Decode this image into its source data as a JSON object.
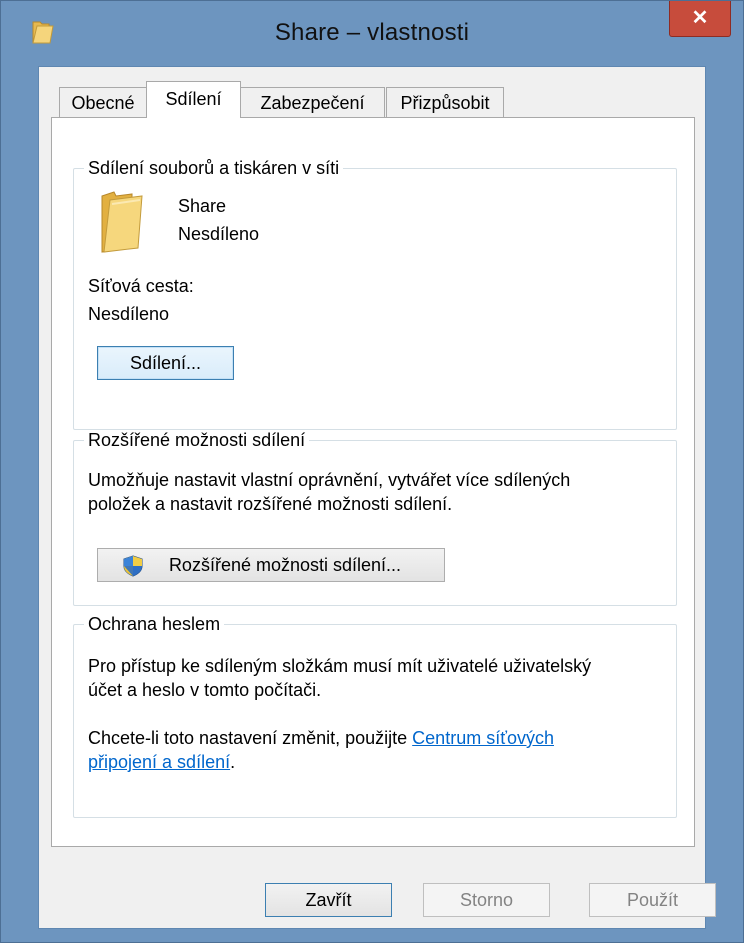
{
  "window": {
    "title": "Share – vlastnosti",
    "close_label": "✕"
  },
  "tabs": [
    {
      "label": "Obecné",
      "active": false
    },
    {
      "label": "Sdílení",
      "active": true
    },
    {
      "label": "Zabezpečení",
      "active": false
    },
    {
      "label": "Přizpůsobit",
      "active": false
    }
  ],
  "sharing_group": {
    "legend": "Sdílení souborů a tiskáren v síti",
    "folder_name": "Share",
    "folder_status": "Nesdíleno",
    "network_path_label": "Síťová cesta:",
    "network_path_value": "Nesdíleno",
    "share_button": "Sdílení..."
  },
  "advanced_group": {
    "legend": "Rozšířené možnosti sdílení",
    "description_line1": "Umožňuje nastavit vlastní oprávnění, vytvářet více sdílených",
    "description_line2": "položek a nastavit rozšířené možnosti sdílení.",
    "advanced_button": "Rozšířené možnosti sdílení..."
  },
  "password_group": {
    "legend": "Ochrana heslem",
    "text_line1": "Pro přístup ke sdíleným složkám musí mít uživatelé uživatelský",
    "text_line2": "účet a heslo v tomto počítači.",
    "change_prefix": "Chcete-li toto nastavení změnit, použijte ",
    "link_line1": "Centrum síťových",
    "link_line2": "připojení a sdílení",
    "change_suffix": "."
  },
  "footer": {
    "close_button": "Zavřít",
    "cancel_button": "Storno",
    "apply_button": "Použít"
  },
  "colors": {
    "frame": "#6d95bf",
    "close": "#c74c3c",
    "link": "#0066cc"
  },
  "icons": {
    "title": "folder-icon",
    "folder": "folder-icon",
    "shield": "uac-shield-icon"
  }
}
